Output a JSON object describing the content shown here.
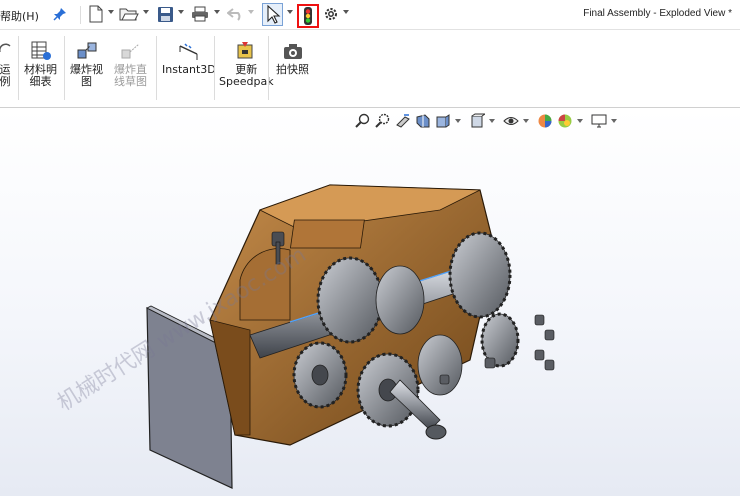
{
  "menu": {
    "help_label": "帮助(H)"
  },
  "document": {
    "title": "Final Assembly - Exploded View *"
  },
  "ribbon": {
    "buttons": [
      {
        "label": "运\n例",
        "disabled": false
      },
      {
        "label": "材料明\n细表",
        "disabled": false
      },
      {
        "label": "爆炸视\n图",
        "disabled": false
      },
      {
        "label": "爆炸直\n线草图",
        "disabled": true
      },
      {
        "label": "Instant3D",
        "disabled": false
      },
      {
        "label": "更新\nSpeedpak",
        "disabled": false
      },
      {
        "label": "拍快照",
        "disabled": false
      }
    ]
  },
  "watermark": {
    "text": "机械时代网 www.jxaoc.com"
  },
  "colors": {
    "housing": "#9c6a33",
    "gears": "#8f939a",
    "highlight": "#e11111",
    "panel": "#7e8290"
  },
  "icons": [
    "pin-icon",
    "new-document-icon",
    "open-icon",
    "save-icon",
    "print-icon",
    "undo-icon",
    "select-icon",
    "traffic-light-icon",
    "options-gear-icon"
  ]
}
